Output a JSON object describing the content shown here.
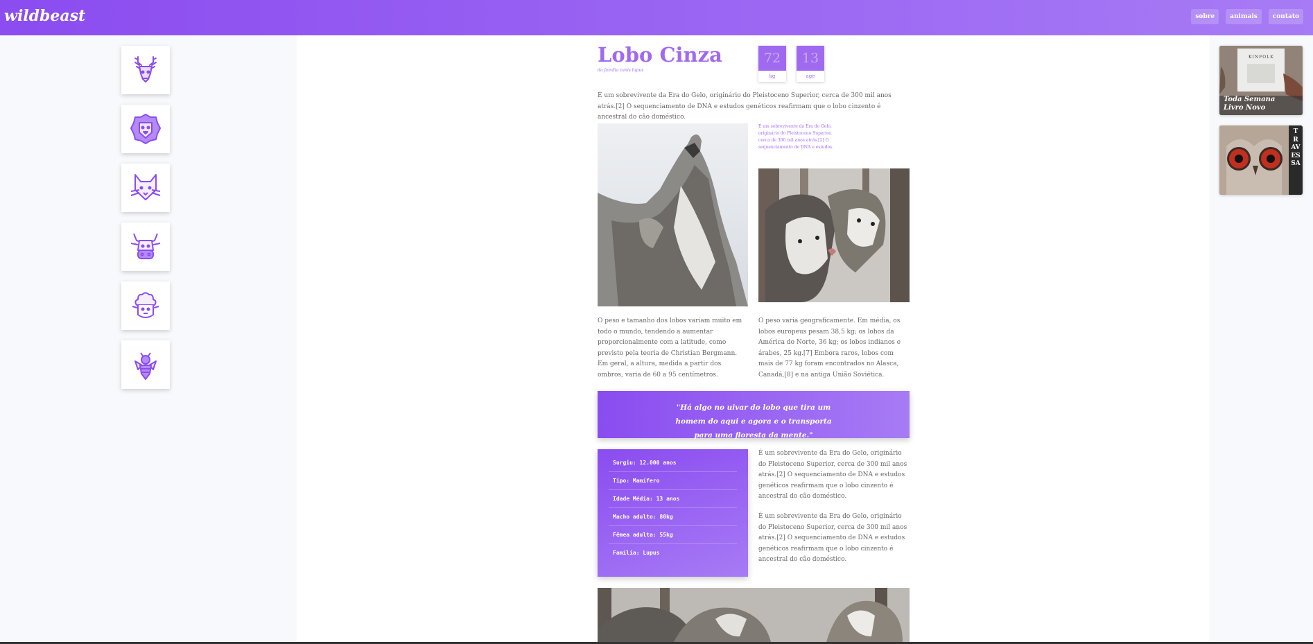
{
  "brand": {
    "logo": "wildbeast"
  },
  "nav": {
    "items": [
      "sobre",
      "animais",
      "contato"
    ]
  },
  "sidebar": {
    "items": [
      {
        "name": "deer",
        "icon": "deer-icon"
      },
      {
        "name": "lion",
        "icon": "lion-icon"
      },
      {
        "name": "fox",
        "icon": "fox-icon"
      },
      {
        "name": "cow",
        "icon": "cow-icon"
      },
      {
        "name": "sheep",
        "icon": "sheep-icon"
      },
      {
        "name": "bee",
        "icon": "bee-icon"
      }
    ]
  },
  "article": {
    "title": "Lobo Cinza",
    "subtitle": "da família canis lupus",
    "stats": [
      {
        "value": "72",
        "label": "kg"
      },
      {
        "value": "13",
        "label": "age"
      }
    ],
    "intro": "É um sobrevivente da Era do Gelo, originário do Pleistoceno Superior, cerca de 300 mil anos atrás.[2] O sequenciamento de DNA e estudos genéticos reafirmam que o lobo cinzento é ancestral do cão doméstico.",
    "side_note": "É um sobrevivente da Era do Gelo, originário do Pleistoceno Superior, cerca de 300 mil anos atrás.[2] O sequenciamento de DNA e estudos.",
    "col_left": "O peso e tamanho dos lobos variam muito em todo o mundo, tendendo a aumentar proporcionalmente com a latitude, como previsto pela teoria de Christian Bergmann. Em geral, a altura, medida a partir dos ombros, varia de 60 a 95 centímetros.",
    "col_right": "O peso varia geograficamente. Em média, os lobos europeus pesam 38,5 kg; os lobos da América do Norte, 36 kg; os lobos indianos e árabes, 25 kg.[7] Embora raros, lobos com mais de 77 kg foram encontrados no Alasca, Canadá,[8] e na antiga União Soviética.",
    "quote": "\"Há algo no uivar do lobo que tira um homem do aqui e agora e o transporta para uma floresta da mente.\"",
    "facts": [
      "Surgiu: 12.000 anos",
      "Tipo: Mamífero",
      "Idade Média: 13 anos",
      "Macho adulto: 80kg",
      "Fêmea adulta: 55kg",
      "Família: Lupus"
    ],
    "facts_text_1": "É um sobrevivente da Era do Gelo, originário do Pleistoceno Superior, cerca de 300 mil anos atrás.[2] O sequenciamento de DNA e estudos genéticos reafirmam que o lobo cinzento é ancestral do cão doméstico.",
    "facts_text_2": "É um sobrevivente da Era do Gelo, originário do Pleistoceno Superior, cerca de 300 mil anos atrás.[2] O sequenciamento de DNA e estudos genéticos reafirmam que o lobo cinzento é ancestral do cão doméstico."
  },
  "ads": [
    {
      "label_line1": "Toda Semana",
      "label_line2": "Livro Novo",
      "magazine": "KINFOLK"
    },
    {
      "vertical_text": "TRAVESSA"
    }
  ],
  "colors": {
    "accent": "#a06af0",
    "accent_dark": "#8b4cf0",
    "panel": "#f8f9fc"
  }
}
